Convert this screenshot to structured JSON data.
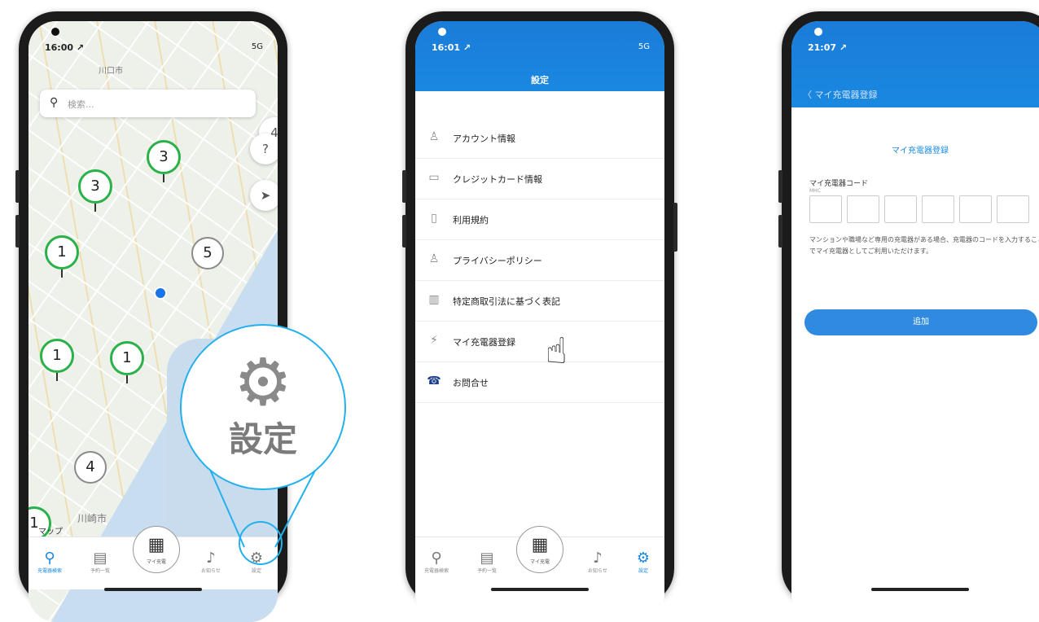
{
  "phone1": {
    "status_time": "16:00 ↗",
    "status_right": "5G",
    "map_label_top": "川口市",
    "search_placeholder": "検索...",
    "clusters": [
      "3",
      "3",
      "1",
      "5",
      "1",
      "1",
      "4",
      "4",
      "1"
    ],
    "fab_help": "?",
    "map_label_bottom": "川崎市",
    "map_label_corner": "マップ",
    "tabs": [
      "充電器検索",
      "予約一覧",
      "マイ充電",
      "お知らせ",
      "設定"
    ],
    "callout_label": "設定"
  },
  "phone2": {
    "status_time": "16:01 ↗",
    "status_right": "5G",
    "header_title": "設定",
    "menu": [
      {
        "icon": "person-icon",
        "label": "アカウント情報"
      },
      {
        "icon": "card-icon",
        "label": "クレジットカード情報"
      },
      {
        "icon": "document-icon",
        "label": "利用規約"
      },
      {
        "icon": "privacy-icon",
        "label": "プライバシーポリシー"
      },
      {
        "icon": "building-icon",
        "label": "特定商取引法に基づく表記"
      },
      {
        "icon": "plug-icon",
        "label": "マイ充電器登録"
      },
      {
        "icon": "phone-icon",
        "label": "お問合せ"
      }
    ],
    "tabs": [
      "充電器検索",
      "予約一覧",
      "マイ充電",
      "お知らせ",
      "設定"
    ]
  },
  "phone3": {
    "status_time": "21:07 ↗",
    "back_label": "〈 マイ充電器登録",
    "form_title": "マイ充電器登録",
    "field_label": "マイ充電器コード",
    "field_sub": "MHC",
    "description": "マンションや職場など専用の充電器がある場合、充電器のコードを入力することでマイ充電器としてご利用いただけます。",
    "add_button": "追加"
  },
  "colors": {
    "accent": "#1a88e0",
    "cluster_green": "#2bb14a",
    "callout_border": "#23b0ec"
  }
}
